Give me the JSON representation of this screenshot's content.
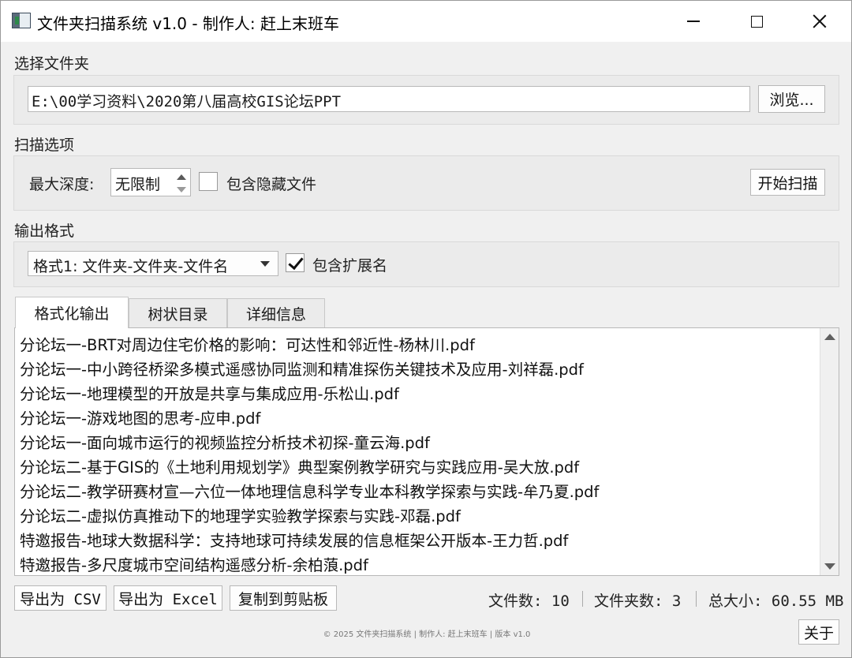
{
  "window": {
    "title": "文件夹扫描系统 v1.0 - 制作人: 赶上末班车"
  },
  "folder": {
    "label": "选择文件夹",
    "path": "E:\\00学习资料\\2020第八届高校GIS论坛PPT",
    "browse_label": "浏览..."
  },
  "scan": {
    "label": "扫描选项",
    "depth_label": "最大深度:",
    "depth_value": "无限制",
    "hidden_label": "包含隐藏文件",
    "hidden_checked": false,
    "start_label": "开始扫描"
  },
  "output": {
    "label": "输出格式",
    "format_value": "格式1: 文件夹-文件夹-文件名",
    "ext_label": "包含扩展名",
    "ext_checked": true
  },
  "tabs": [
    {
      "label": "格式化输出",
      "active": true
    },
    {
      "label": "树状目录",
      "active": false
    },
    {
      "label": "详细信息",
      "active": false
    }
  ],
  "result_lines": [
    "分论坛一-BRT对周边住宅价格的影响：可达性和邻近性-杨林川.pdf",
    "分论坛一-中小跨径桥梁多模式遥感协同监测和精准探伤关键技术及应用-刘祥磊.pdf",
    "分论坛一-地理模型的开放是共享与集成应用-乐松山.pdf",
    "分论坛一-游戏地图的思考-应申.pdf",
    "分论坛一-面向城市运行的视频监控分析技术初探-童云海.pdf",
    "分论坛二-基于GIS的《土地利用规划学》典型案例教学研究与实践应用-吴大放.pdf",
    "分论坛二-教学研赛材宣—六位一体地理信息科学专业本科教学探索与实践-牟乃夏.pdf",
    "分论坛二-虚拟仿真推动下的地理学实验教学探索与实践-邓磊.pdf",
    "特邀报告-地球大数据科学：支持地球可持续发展的信息框架公开版本-王力哲.pdf",
    "特邀报告-多尺度城市空间结构遥感分析-余柏蒗.pdf"
  ],
  "actions": {
    "export_csv": "导出为 CSV",
    "export_excel": "导出为 Excel",
    "copy_clipboard": "复制到剪贴板"
  },
  "stats": {
    "file_count": "文件数: 10",
    "folder_count": "文件夹数: 3",
    "total_size": "总大小: 60.55 MB"
  },
  "footer": {
    "text": "© 2025 文件夹扫描系统 | 制作人: 赶上末班车 | 版本 v1.0",
    "about_label": "关于"
  }
}
